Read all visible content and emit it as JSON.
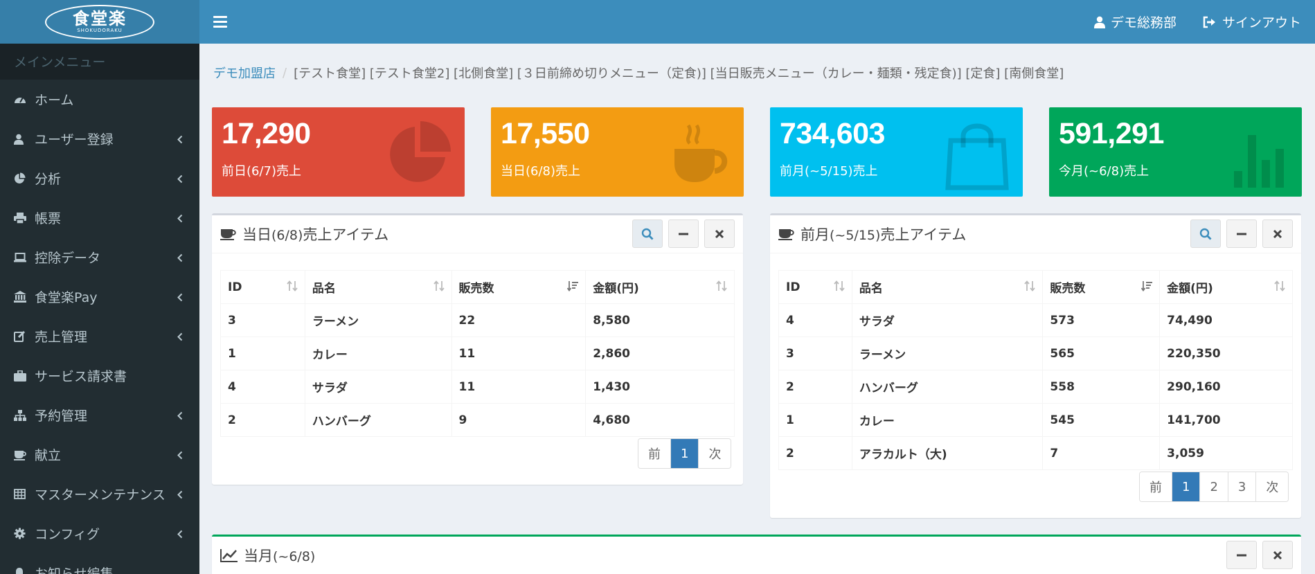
{
  "logo": {
    "main": "食堂楽",
    "sub": "SHOKUDORAKU"
  },
  "sidebar": {
    "header": "メインメニュー",
    "items": [
      {
        "label": "ホーム",
        "icon": "dashboard-icon",
        "chevron": false
      },
      {
        "label": "ユーザー登録",
        "icon": "user-icon",
        "chevron": true
      },
      {
        "label": "分析",
        "icon": "pie-chart-icon",
        "chevron": true
      },
      {
        "label": "帳票",
        "icon": "print-icon",
        "chevron": true
      },
      {
        "label": "控除データ",
        "icon": "laptop-icon",
        "chevron": true
      },
      {
        "label": "食堂楽Pay",
        "icon": "bank-icon",
        "chevron": true
      },
      {
        "label": "売上管理",
        "icon": "edit-icon",
        "chevron": true
      },
      {
        "label": "サービス請求書",
        "icon": "briefcase-icon",
        "chevron": false
      },
      {
        "label": "予約管理",
        "icon": "sitemap-icon",
        "chevron": true
      },
      {
        "label": "献立",
        "icon": "coffee-icon",
        "chevron": true
      },
      {
        "label": "マスターメンテナンス",
        "icon": "table-icon",
        "chevron": true
      },
      {
        "label": "コンフィグ",
        "icon": "gear-icon",
        "chevron": true
      },
      {
        "label": "お知らせ編集",
        "icon": "bell-icon",
        "chevron": false
      }
    ]
  },
  "header": {
    "user": "デモ総務部",
    "signout": "サインアウト"
  },
  "breadcrumb": {
    "home": "デモ加盟店",
    "sep": "/",
    "rest": "[テスト食堂] [テスト食堂2] [北側食堂] [３日前締め切りメニュー（定食)] [当日販売メニュー（カレー・麺類・残定食)] [定食] [南側食堂]"
  },
  "stats": [
    {
      "value": "17,290",
      "label": "前日(6/7)売上",
      "color": "#dd4b39",
      "icon": "pie-chart-icon"
    },
    {
      "value": "17,550",
      "label": "当日(6/8)売上",
      "color": "#f39c12",
      "icon": "coffee-icon"
    },
    {
      "value": "734,603",
      "label": "前月(~5/15)売上",
      "color": "#00c0ef",
      "icon": "shopping-bag-icon"
    },
    {
      "value": "591,291",
      "label": "今月(~6/8)売上",
      "color": "#00a65a",
      "icon": "bar-chart-icon"
    }
  ],
  "today_panel": {
    "title": "当日",
    "title_small": "(6/8)",
    "title_rest": "売上アイテム",
    "columns": [
      "ID",
      "品名",
      "販売数",
      "金額(円)"
    ],
    "rows": [
      [
        "3",
        "ラーメン",
        "22",
        "8,580"
      ],
      [
        "1",
        "カレー",
        "11",
        "2,860"
      ],
      [
        "4",
        "サラダ",
        "11",
        "1,430"
      ],
      [
        "2",
        "ハンバーグ",
        "9",
        "4,680"
      ]
    ],
    "pager": [
      "前",
      "1",
      "次"
    ]
  },
  "month_panel": {
    "title": "前月",
    "title_small": "(~5/15)",
    "title_rest": "売上アイテム",
    "columns": [
      "ID",
      "品名",
      "販売数",
      "金額(円)"
    ],
    "rows": [
      [
        "4",
        "サラダ",
        "573",
        "74,490"
      ],
      [
        "3",
        "ラーメン",
        "565",
        "220,350"
      ],
      [
        "2",
        "ハンバーグ",
        "558",
        "290,160"
      ],
      [
        "1",
        "カレー",
        "545",
        "141,700"
      ],
      [
        "2",
        "アラカルト（大)",
        "7",
        "3,059"
      ]
    ],
    "pager": [
      "前",
      "1",
      "2",
      "3",
      "次"
    ]
  },
  "bottom_panel": {
    "title": "当月",
    "title_small": "(~6/8)"
  }
}
